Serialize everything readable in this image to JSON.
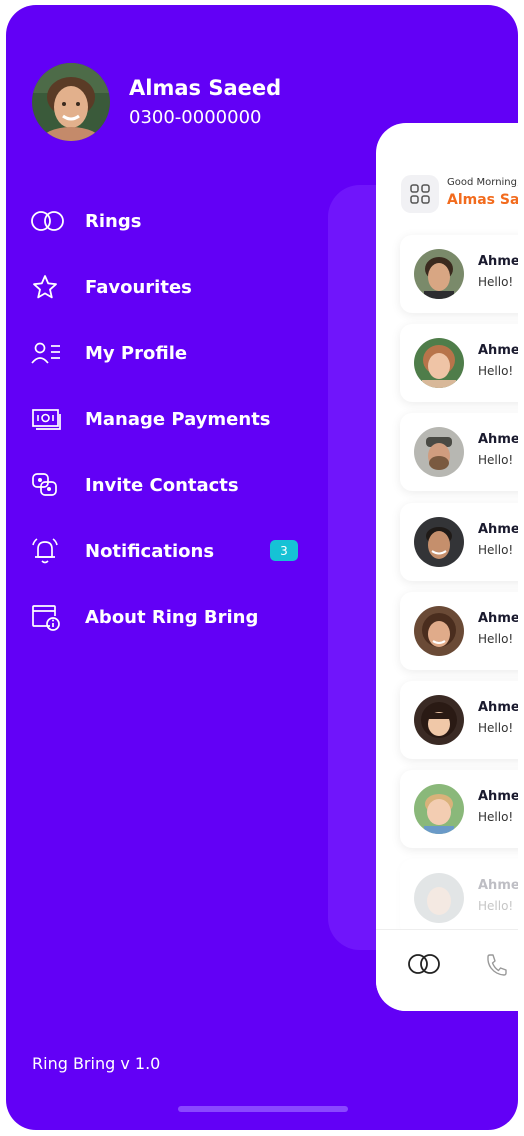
{
  "profile": {
    "name": "Almas Saeed",
    "phone": "0300-0000000"
  },
  "menu": {
    "items": [
      {
        "label": "Rings",
        "icon": "rings-icon"
      },
      {
        "label": "Favourites",
        "icon": "star-icon"
      },
      {
        "label": "My Profile",
        "icon": "profile-icon"
      },
      {
        "label": "Manage Payments",
        "icon": "payments-icon"
      },
      {
        "label": "Invite Contacts",
        "icon": "invite-icon"
      },
      {
        "label": "Notifications",
        "icon": "bell-icon",
        "badge": "3"
      },
      {
        "label": "About Ring Bring",
        "icon": "info-icon"
      }
    ]
  },
  "footer": {
    "version": "Ring Bring v 1.0"
  },
  "home": {
    "greeting": "Good Morning,",
    "greet_name": "Almas Saeed",
    "chats": [
      {
        "name": "Ahmed",
        "message": "Hello! I"
      },
      {
        "name": "Ahmed",
        "message": "Hello! I"
      },
      {
        "name": "Ahmed",
        "message": "Hello! I"
      },
      {
        "name": "Ahmed",
        "message": "Hello! I"
      },
      {
        "name": "Ahmed",
        "message": "Hello! I"
      },
      {
        "name": "Ahmed",
        "message": "Hello! I"
      },
      {
        "name": "Ahmed",
        "message": "Hello! I"
      },
      {
        "name": "Ahmed",
        "message": "Hello! I"
      }
    ],
    "tabs": [
      "rings-icon",
      "phone-icon"
    ]
  },
  "colors": {
    "brand": "#6200f6",
    "accent": "#f26b1d",
    "badge": "#16c2d5"
  }
}
